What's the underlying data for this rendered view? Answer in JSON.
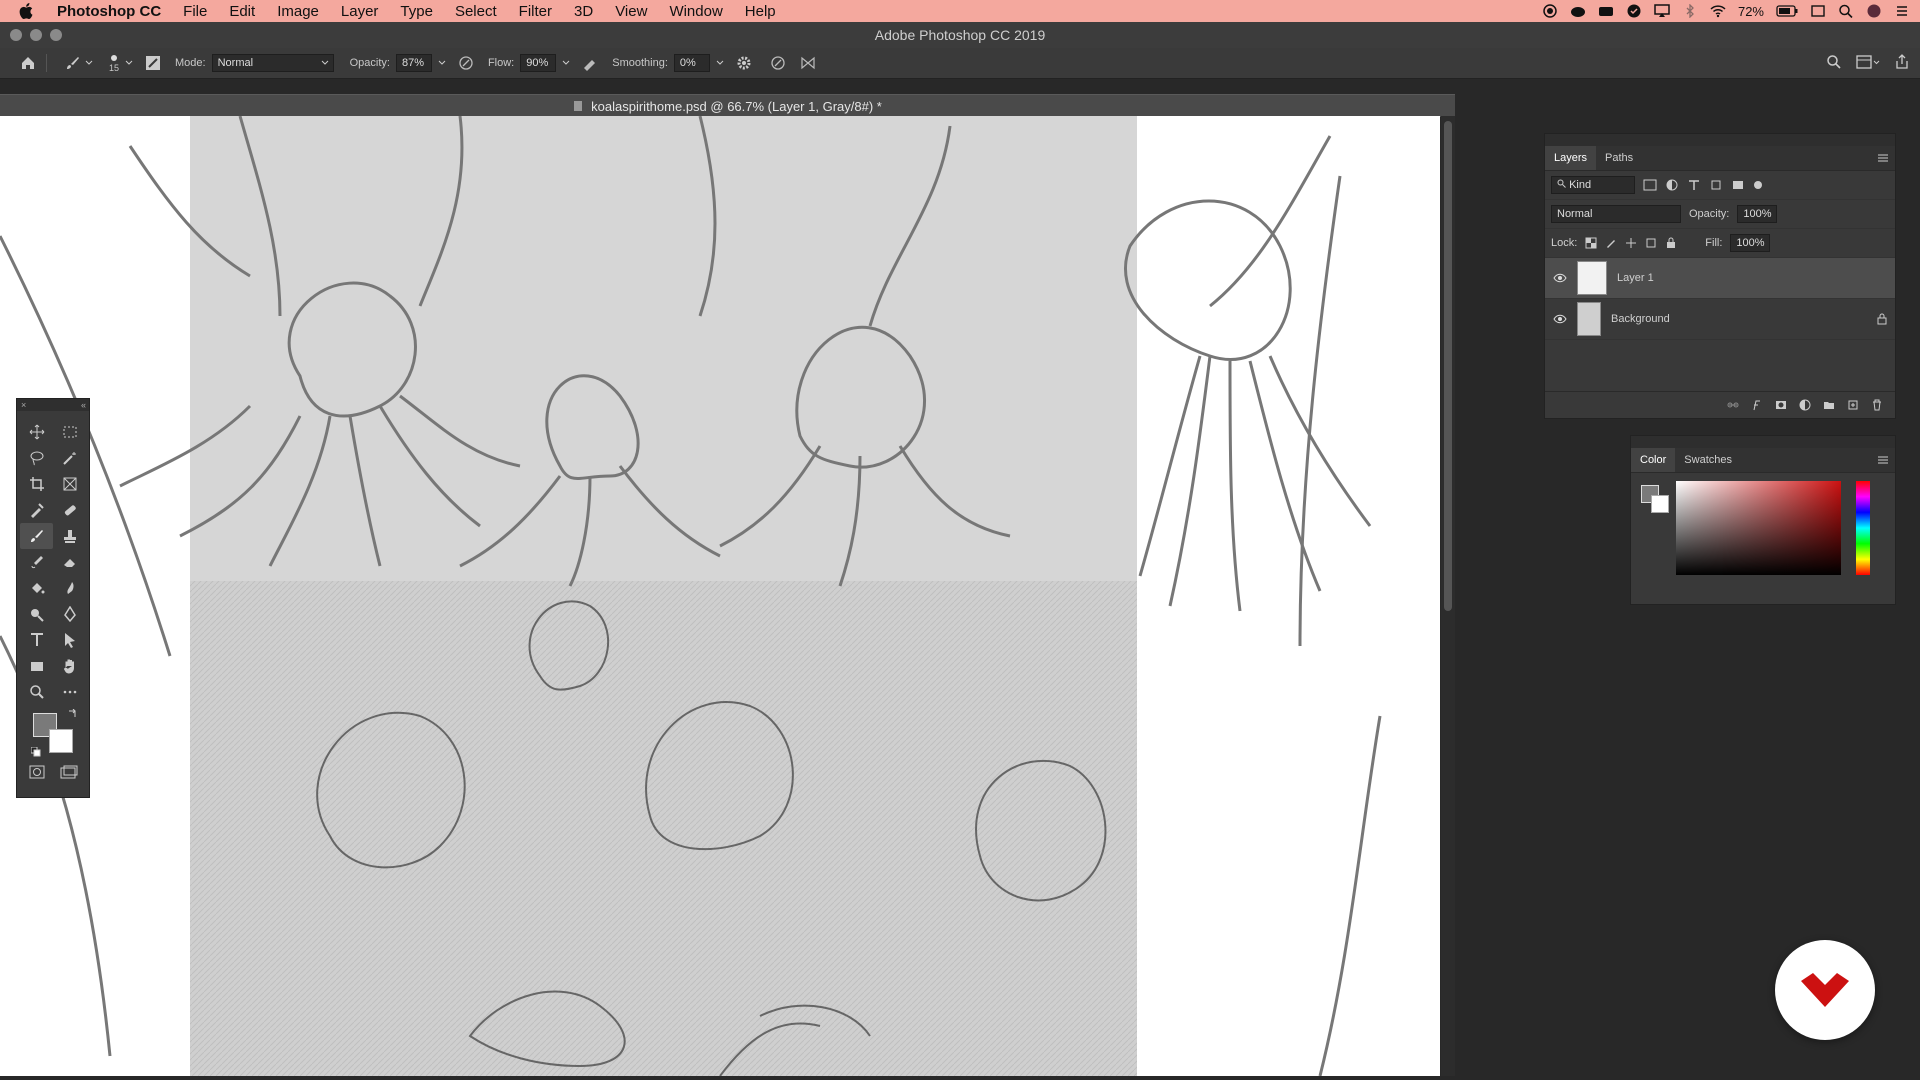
{
  "menubar": {
    "app_name": "Photoshop CC",
    "items": [
      "File",
      "Edit",
      "Image",
      "Layer",
      "Type",
      "Select",
      "Filter",
      "3D",
      "View",
      "Window",
      "Help"
    ],
    "battery": "72%"
  },
  "window": {
    "title": "Adobe Photoshop CC 2019"
  },
  "options": {
    "brush_size": "15",
    "mode_label": "Mode:",
    "mode_value": "Normal",
    "opacity_label": "Opacity:",
    "opacity_value": "87%",
    "flow_label": "Flow:",
    "flow_value": "90%",
    "smoothing_label": "Smoothing:",
    "smoothing_value": "0%"
  },
  "document": {
    "tab_title": "koalaspirithome.psd @ 66.7% (Layer 1, Gray/8#) *"
  },
  "layers_panel": {
    "tabs": [
      "Layers",
      "Paths"
    ],
    "filter_value": "Kind",
    "blend_mode": "Normal",
    "opacity_label": "Opacity:",
    "opacity_value": "100%",
    "lock_label": "Lock:",
    "fill_label": "Fill:",
    "fill_value": "100%",
    "layers": [
      {
        "name": "Layer 1"
      },
      {
        "name": "Background"
      }
    ]
  },
  "color_panel": {
    "tabs": [
      "Color",
      "Swatches"
    ]
  },
  "colors": {
    "menubar_bg": "#f4a89e",
    "accent_red": "#cc1111",
    "foreground_swatch": "#7a7a7a",
    "background_swatch": "#ffffff"
  }
}
